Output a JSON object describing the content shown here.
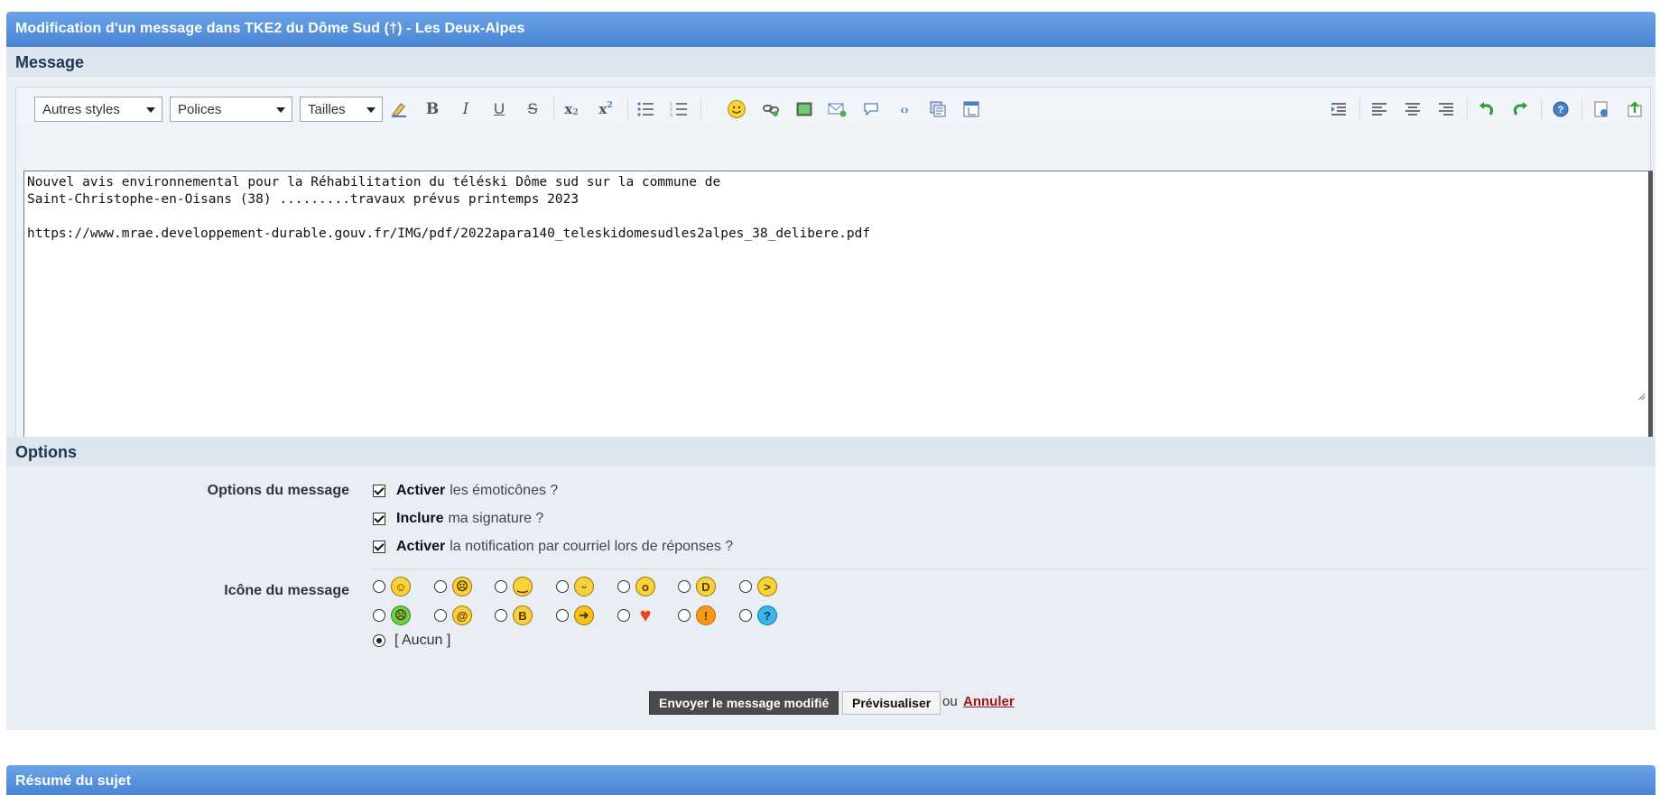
{
  "header": {
    "title": "Modification d'un message dans TKE2 du Dôme Sud (†) - Les Deux-Alpes"
  },
  "message_section": {
    "heading": "Message",
    "toolbar": {
      "style_select": "Autres styles",
      "font_select": "Polices",
      "size_select": "Tailles"
    },
    "content": "Nouvel avis environnemental pour la Réhabilitation du téléski Dôme sud sur la commune de\nSaint-Christophe-en-Oisans (38) .........travaux prévus printemps 2023\n\nhttps://www.mrae.developpement-durable.gouv.fr/IMG/pdf/2022apara140_teleskidomesudles2alpes_38_delibere.pdf"
  },
  "options_section": {
    "heading": "Options",
    "message_options_label": "Options du message",
    "checkboxes": [
      {
        "bold": "Activer",
        "text": "les émoticônes ?",
        "checked": true
      },
      {
        "bold": "Inclure",
        "text": "ma signature ?",
        "checked": true
      },
      {
        "bold": "Activer",
        "text": "la notification par courriel lors de réponses ?",
        "checked": true
      }
    ],
    "message_icon_label": "Icône du message",
    "icons_row1": [
      "smile-icon",
      "frown-icon",
      "sleepy-icon",
      "grin-icon",
      "surprised-icon",
      "laugh-icon",
      "angry-icon"
    ],
    "icons_row2": [
      "sick-icon",
      "confused-icon",
      "cool-icon",
      "arrow-icon",
      "heart-icon",
      "exclamation-icon",
      "question-icon"
    ],
    "none_option": "[ Aucun ]"
  },
  "actions": {
    "submit_label": "Envoyer le message modifié",
    "preview_label": "Prévisualiser",
    "or_text": "ou",
    "cancel_label": "Annuler"
  },
  "summary_bar": {
    "title": "Résumé du sujet"
  },
  "colors": {
    "header_blue": "#4a85d4",
    "panel_bg": "#e9eef5",
    "cancel_red": "#a31515"
  }
}
